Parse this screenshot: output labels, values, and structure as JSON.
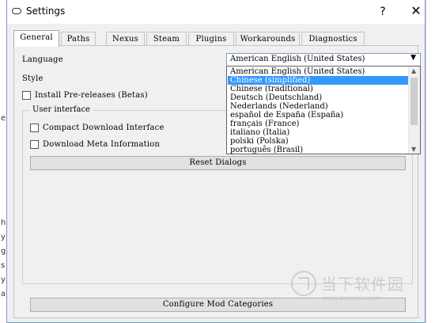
{
  "window": {
    "title": "Settings",
    "help_glyph": "?",
    "close_glyph": "✕"
  },
  "background": {
    "left_fragments": [
      "e",
      "h",
      "y",
      "g",
      "s",
      "y",
      "a"
    ]
  },
  "tabs": [
    {
      "label": "General",
      "active": true
    },
    {
      "label": "Paths"
    },
    {
      "label": "Nexus"
    },
    {
      "label": "Steam"
    },
    {
      "label": "Plugins"
    },
    {
      "label": "Workarounds"
    },
    {
      "label": "Diagnostics"
    }
  ],
  "general": {
    "language_label": "Language",
    "style_label": "Style",
    "prereleases_label": "Install Pre-releases (Betas)",
    "user_interface_title": "User interface",
    "compact_label": "Compact Download Interface",
    "meta_label": "Download Meta Information",
    "reset_dialogs_label": "Reset Dialogs",
    "configure_mod_categories_label": "Configure Mod Categories"
  },
  "language_select": {
    "value": "American English (United States)",
    "options": [
      "American English (United States)",
      "Chinese (simplified)",
      "Chinese (traditional)",
      "Deutsch (Deutschland)",
      "Nederlands (Nederland)",
      "español de España (España)",
      "français (France)",
      "italiano (Italia)",
      "polski (Polska)",
      "português (Brasil)"
    ],
    "highlighted_index": 1
  },
  "watermark": {
    "cn": "当下软件园",
    "url": "www.downxia.com"
  },
  "colors": {
    "accent": "#3399ff",
    "window_bg": "#f0f0f0"
  }
}
